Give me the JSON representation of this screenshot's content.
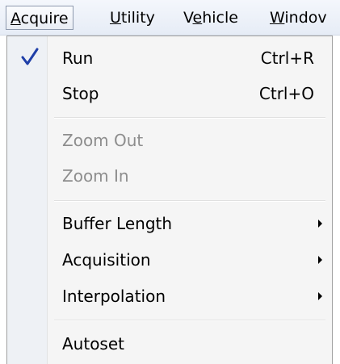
{
  "menubar": {
    "items": [
      {
        "pre": "",
        "ul": "A",
        "post": "cquire"
      },
      {
        "pre": "",
        "ul": "U",
        "post": "tility"
      },
      {
        "pre": "V",
        "ul": "e",
        "post": "hicle"
      },
      {
        "pre": "",
        "ul": "W",
        "post": "indov"
      }
    ]
  },
  "dropdown": {
    "run": {
      "label": "Run",
      "shortcut": "Ctrl+R",
      "checked": true
    },
    "stop": {
      "label": "Stop",
      "shortcut": "Ctrl+O"
    },
    "zoom_out": {
      "label": "Zoom Out",
      "disabled": true
    },
    "zoom_in": {
      "label": "Zoom In",
      "disabled": true
    },
    "buffer_length": {
      "label": "Buffer Length",
      "submenu": true
    },
    "acquisition": {
      "label": "Acquisition",
      "submenu": true
    },
    "interpolation": {
      "label": "Interpolation",
      "submenu": true
    },
    "autoset": {
      "label": "Autoset"
    }
  },
  "colors": {
    "checkmark": "#1f3fa8",
    "disabled_text": "#8d8d8d"
  }
}
